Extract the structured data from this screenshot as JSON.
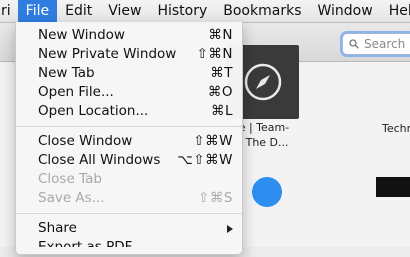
{
  "menubar": {
    "items": [
      "ri",
      "File",
      "Edit",
      "View",
      "History",
      "Bookmarks",
      "Window",
      "Help"
    ]
  },
  "search": {
    "placeholder": "Search"
  },
  "tiles": {
    "main_label_line1": "me | Team-",
    "main_label_line2": "P - The D...",
    "right_label": "Techn"
  },
  "menu": {
    "groups": [
      [
        {
          "label": "New Window",
          "shortcut": "⌘N"
        },
        {
          "label": "New Private Window",
          "shortcut": "⇧⌘N"
        },
        {
          "label": "New Tab",
          "shortcut": "⌘T"
        },
        {
          "label": "Open File...",
          "shortcut": "⌘O"
        },
        {
          "label": "Open Location...",
          "shortcut": "⌘L"
        }
      ],
      [
        {
          "label": "Close Window",
          "shortcut": "⇧⌘W"
        },
        {
          "label": "Close All Windows",
          "shortcut": "⌥⇧⌘W"
        },
        {
          "label": "Close Tab",
          "shortcut": "",
          "disabled": true
        },
        {
          "label": "Save As...",
          "shortcut": "⇧⌘S",
          "disabled": true
        }
      ],
      [
        {
          "label": "Share",
          "shortcut": "",
          "submenu": true
        },
        {
          "label": "Export as PDF...",
          "shortcut": ""
        }
      ]
    ]
  },
  "colors": {
    "accent": "#2f7de1"
  }
}
